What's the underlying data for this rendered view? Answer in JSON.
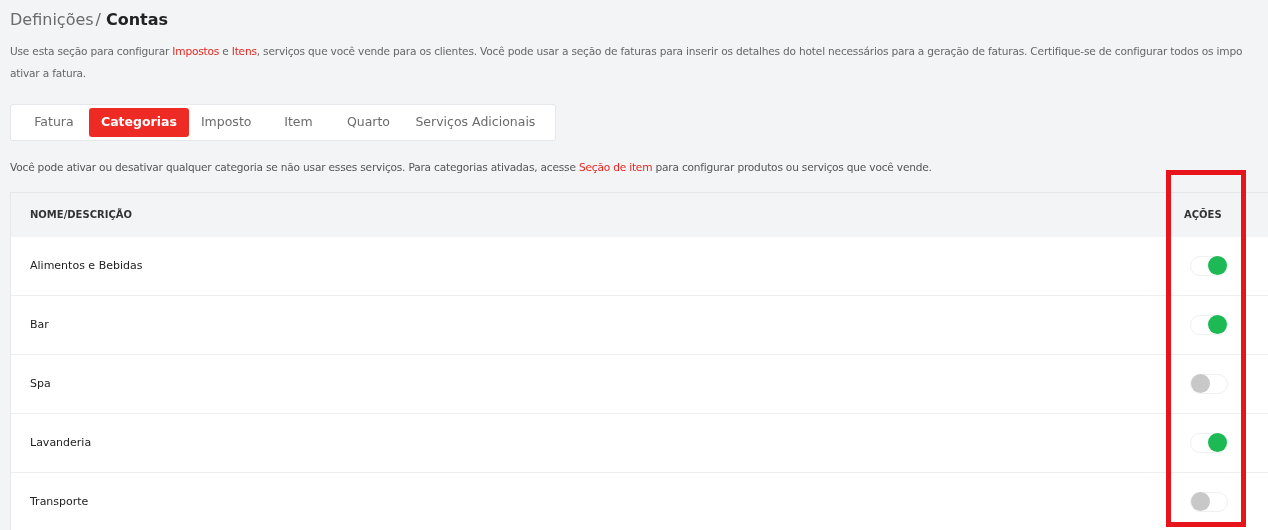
{
  "breadcrumb": {
    "parent": "Definições",
    "separator": "/",
    "current": "Contas"
  },
  "intro_lines": [
    [
      {
        "kind": "text",
        "text": "Use esta seção para configurar "
      },
      {
        "kind": "link",
        "text": "Impostos"
      },
      {
        "kind": "text",
        "text": " e "
      },
      {
        "kind": "link",
        "text": "Itens"
      },
      {
        "kind": "text",
        "text": ", serviços que você vende para os clientes. Você pode usar a seção de faturas para inserir os detalhes do hotel necessários para a geração de faturas. Certifique-se de configurar todos os impo"
      }
    ],
    [
      {
        "kind": "text",
        "text": "ativar a fatura."
      }
    ]
  ],
  "tabs": [
    {
      "label": "Fatura",
      "selected": false
    },
    {
      "label": "Categorias",
      "selected": true
    },
    {
      "label": "Imposto",
      "selected": false
    },
    {
      "label": "Item",
      "selected": false
    },
    {
      "label": "Quarto",
      "selected": false
    },
    {
      "label": "Serviços Adicionais",
      "selected": false
    }
  ],
  "note": [
    {
      "kind": "text",
      "text": "Você pode ativar ou desativar qualquer categoria se não usar esses serviços. Para categorias ativadas, acesse "
    },
    {
      "kind": "link",
      "text": "Seção de item"
    },
    {
      "kind": "text",
      "text": " para configurar produtos ou serviços que você vende."
    }
  ],
  "table": {
    "columns": [
      "NOME/DESCRIÇÃO",
      "AÇÕES"
    ],
    "rows": [
      {
        "name": "Alimentos e Bebidas",
        "on": true
      },
      {
        "name": "Bar",
        "on": true
      },
      {
        "name": "Spa",
        "on": false
      },
      {
        "name": "Lavanderia",
        "on": true
      },
      {
        "name": "Transporte",
        "on": false
      }
    ]
  }
}
